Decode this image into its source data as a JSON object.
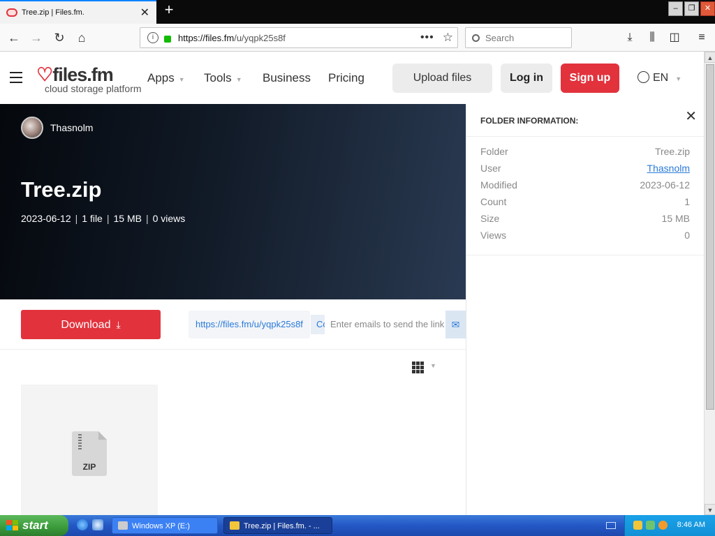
{
  "browser": {
    "tab_title": "Tree.zip | Files.fm.",
    "tab_close": "✕",
    "new_tab": "+",
    "url_host": "https://files.fm",
    "url_path": "/u/yqpk25s8f",
    "page_actions": "•••",
    "search_placeholder": "Search",
    "window_buttons": [
      "–",
      "❐",
      "✕"
    ]
  },
  "site": {
    "logo_main": "files.fm",
    "logo_sub": "cloud storage platform",
    "nav": [
      "Apps",
      "Tools",
      "Business",
      "Pricing"
    ],
    "upload_label": "Upload files",
    "login_label": "Log in",
    "signup_label": "Sign up",
    "language": "EN"
  },
  "hero": {
    "owner": "Thasnolm",
    "title": "Tree.zip",
    "date": "2023-06-12",
    "files": "1 file",
    "size": "15 MB",
    "views": "0 views",
    "separator": "|"
  },
  "actions": {
    "download_label": "Download",
    "share_link": "https://files.fm/u/yqpk25s8f",
    "copy_label": "Copy",
    "email_placeholder": "Enter emails to send the link",
    "send_icon": "✉"
  },
  "files": [
    {
      "type_label": "ZIP"
    }
  ],
  "panel": {
    "title": "FOLDER INFORMATION:",
    "close": "✕",
    "rows": [
      {
        "label": "Folder",
        "value": "Tree.zip"
      },
      {
        "label": "User",
        "value": "Thasnolm"
      },
      {
        "label": "Modified",
        "value": "2023-06-12"
      },
      {
        "label": "Count",
        "value": "1"
      },
      {
        "label": "Size",
        "value": "15 MB"
      },
      {
        "label": "Views",
        "value": "0"
      }
    ]
  },
  "taskbar": {
    "start_label": "start",
    "tasks": [
      "Windows XP (E:)",
      "Tree.zip | Files.fm. - ..."
    ],
    "clock": "8:46 AM"
  }
}
